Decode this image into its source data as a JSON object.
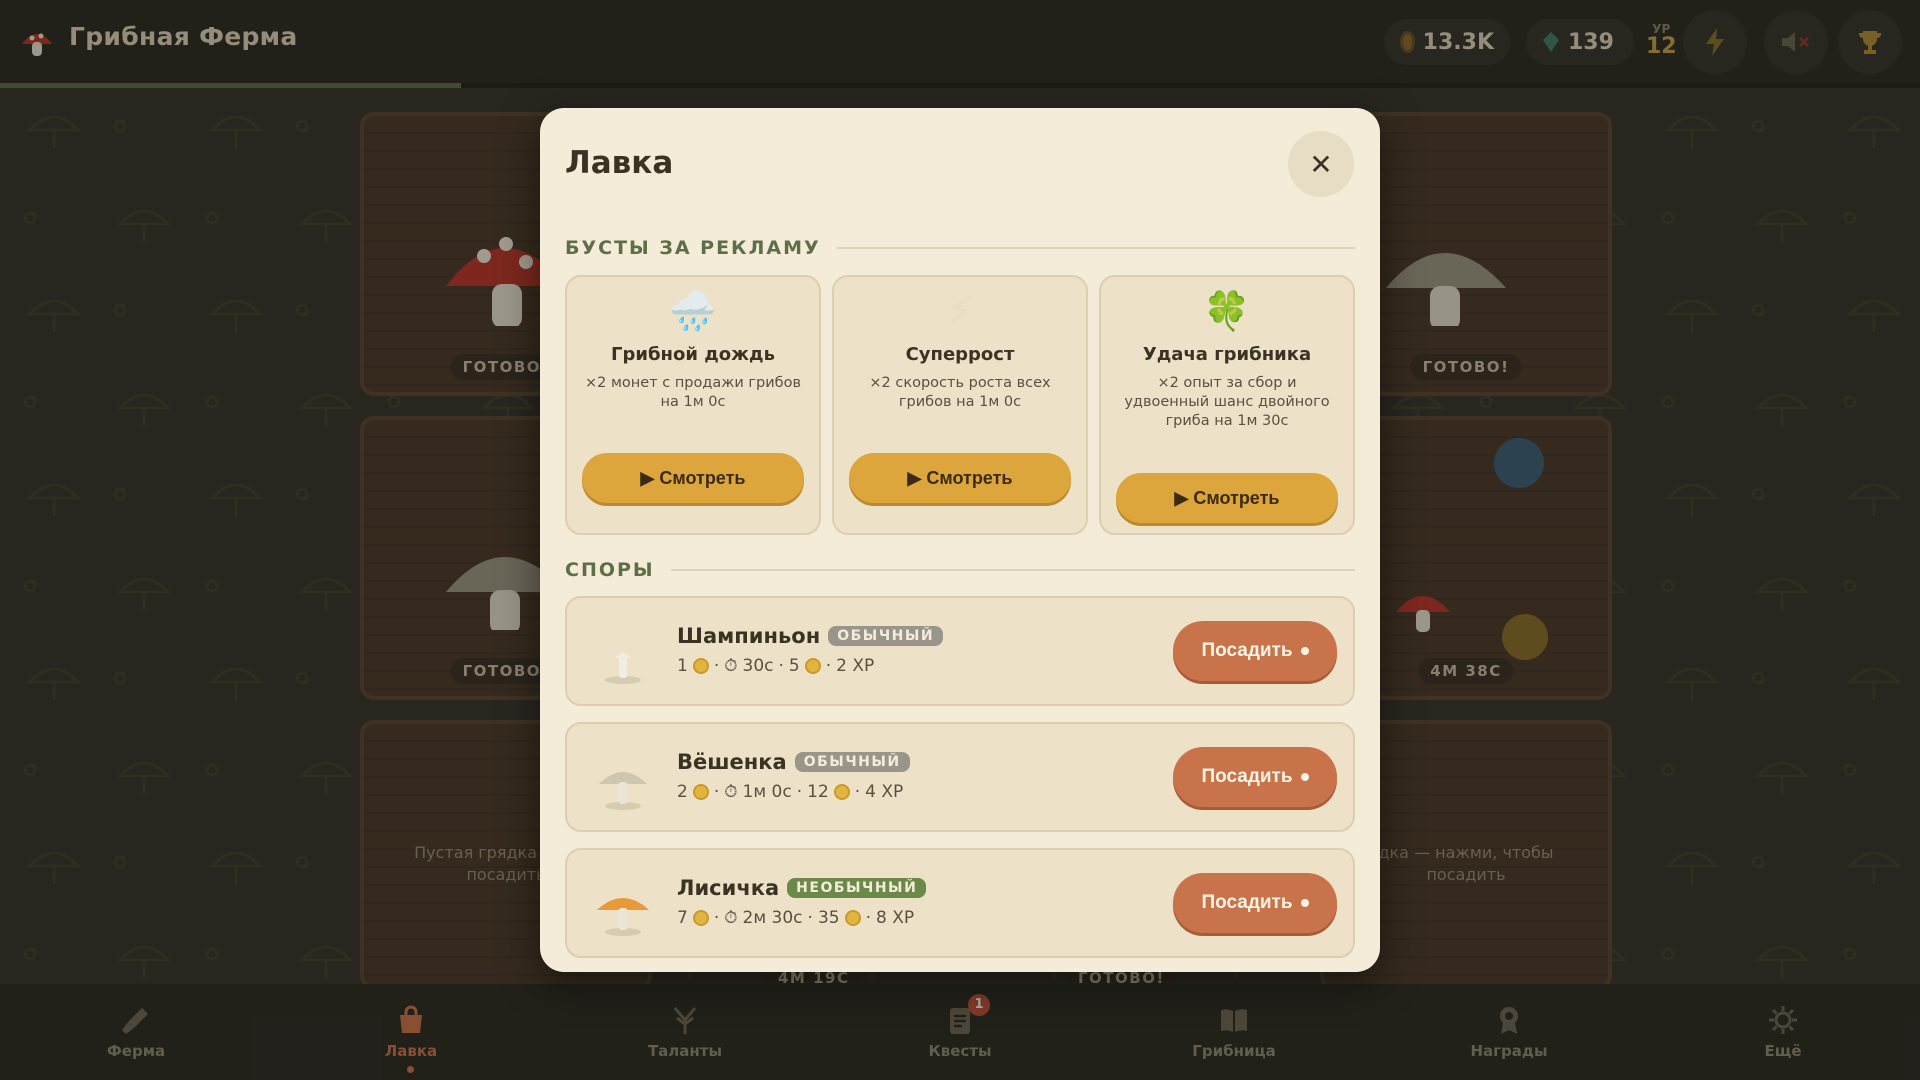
{
  "app": {
    "title": "Грибная Ферма",
    "xp_progress": 0.24
  },
  "stats": {
    "coins": "13.3K",
    "gems": "139",
    "level_label": "УР",
    "level": "12"
  },
  "plots": {
    "ready": "ГОТОВО!",
    "empty_text": "Пустая грядка — нажми, чтобы посадить",
    "empty_text_left": "Пустая грядка — наж",
    "empty_text_left_2": "посадить",
    "empty_text_right": "дка — нажми, чтобы",
    "empty_text_right_2": "посадить",
    "timer_right": "4М 38С",
    "timer_bottom": "4М 19С",
    "ready_bottom": "ГОТОВО!"
  },
  "shop": {
    "title": "Лавка",
    "close_symbol": "✕",
    "boosts_title": "БУСТЫ ЗА РЕКЛАМУ",
    "spores_title": "СПОРЫ",
    "boosts": [
      {
        "icon": "🌧️",
        "title": "Грибной дождь",
        "desc": "×2 монет с продажи грибов на 1м 0с",
        "button": "▶ Смотреть"
      },
      {
        "icon": "⚡",
        "title": "Суперрост",
        "desc": "×2 скорость роста всех грибов на 1м 0с",
        "button": "▶ Смотреть"
      },
      {
        "icon": "🍀",
        "title": "Удача грибника",
        "desc": "×2 опыт за сбор и удвоенный шанс двойного гриба на 1м 30с",
        "button": "▶ Смотреть"
      }
    ],
    "spores": [
      {
        "name": "Шампиньон",
        "rarity": "ОБЫЧНЫЙ",
        "cost": "1",
        "time": "30с",
        "reward": "5",
        "xp": "2 XP",
        "button": "Посадить",
        "color": "#f2ede2"
      },
      {
        "name": "Вёшенка",
        "rarity": "ОБЫЧНЫЙ",
        "cost": "2",
        "time": "1м 0с",
        "reward": "12",
        "xp": "4 XP",
        "button": "Посадить",
        "color": "#cfc6ad"
      },
      {
        "name": "Лисичка",
        "rarity": "НЕОБЫЧНЫЙ",
        "cost": "7",
        "time": "2м 30с",
        "reward": "35",
        "xp": "8 XP",
        "button": "Посадить",
        "color": "#e89a3a"
      }
    ]
  },
  "nav": {
    "items": [
      {
        "label": "Ферма"
      },
      {
        "label": "Лавка"
      },
      {
        "label": "Таланты"
      },
      {
        "label": "Квесты",
        "badge": "1"
      },
      {
        "label": "Грибница"
      },
      {
        "label": "Награды"
      },
      {
        "label": "Ещё"
      }
    ]
  },
  "colors": {
    "accent": "#c9734a",
    "gold": "#dca63c",
    "green": "#5d6f46"
  }
}
